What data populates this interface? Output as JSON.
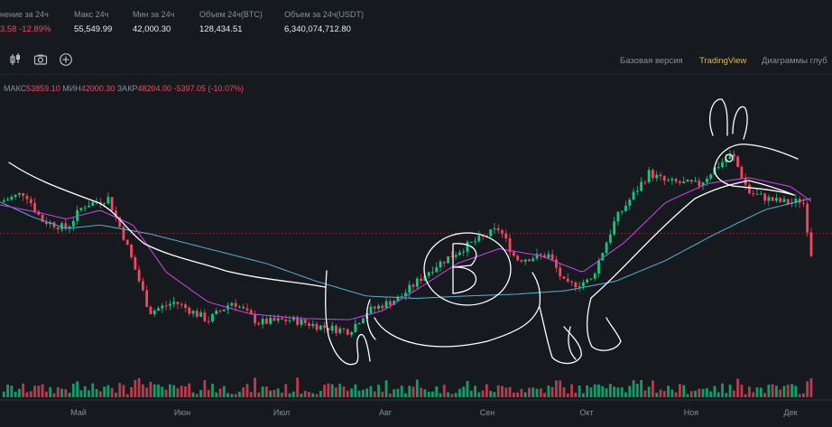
{
  "stats": [
    {
      "label": "нение за 24ч",
      "value": "3.58 -12.89%",
      "negative": true
    },
    {
      "label": "Макс 24ч",
      "value": "55,549.99",
      "negative": false
    },
    {
      "label": "Мин за 24ч",
      "value": "42,000.30",
      "negative": false
    },
    {
      "label": "Объем 24ч(BTC)",
      "value": "128,434.51",
      "negative": false
    },
    {
      "label": "Объем за 24ч(USDT)",
      "value": "6,340,074,712.80",
      "negative": false
    }
  ],
  "toolbar": {
    "icons": [
      "candlestick-icon",
      "camera-icon",
      "plus-circle-icon"
    ],
    "tabs": [
      "Базовая версия",
      "TradingView",
      "Диаграммы глуб"
    ],
    "active_tab": "TradingView"
  },
  "ohlc": {
    "high_label": "МАКС",
    "high": "53859.10",
    "low_label": "МИН",
    "low": "42000.30",
    "close_label": "ЗАКР",
    "close": "48204.00",
    "change": "-5397.05 (-10.07%)"
  },
  "colors": {
    "up": "#0ecb81",
    "down": "#f6465d",
    "ma_short": "#c33fe0",
    "ma_long": "#4aa7c9",
    "accent": "#f0b90b"
  },
  "chart_data": {
    "type": "candlestick",
    "x_ticks": [
      "Май",
      "Июн",
      "Июл",
      "Авг",
      "Сен",
      "Окт",
      "Ноя",
      "Дек"
    ],
    "price_path": [
      [
        0,
        56900
      ],
      [
        0.03,
        58500
      ],
      [
        0.05,
        53800
      ],
      [
        0.08,
        52400
      ],
      [
        0.1,
        56300
      ],
      [
        0.13,
        57500
      ],
      [
        0.15,
        50600
      ],
      [
        0.18,
        38300
      ],
      [
        0.21,
        40000
      ],
      [
        0.25,
        36900
      ],
      [
        0.28,
        40100
      ],
      [
        0.31,
        36500
      ],
      [
        0.35,
        37000
      ],
      [
        0.39,
        35700
      ],
      [
        0.42,
        35100
      ],
      [
        0.44,
        38300
      ],
      [
        0.48,
        40700
      ],
      [
        0.52,
        45800
      ],
      [
        0.56,
        49400
      ],
      [
        0.6,
        52400
      ],
      [
        0.62,
        47200
      ],
      [
        0.66,
        47900
      ],
      [
        0.68,
        42700
      ],
      [
        0.71,
        43600
      ],
      [
        0.74,
        54000
      ],
      [
        0.78,
        61800
      ],
      [
        0.8,
        60300
      ],
      [
        0.84,
        59800
      ],
      [
        0.86,
        62700
      ],
      [
        0.88,
        65000
      ],
      [
        0.9,
        58500
      ],
      [
        0.93,
        57100
      ],
      [
        0.95,
        56700
      ],
      [
        0.965,
        57300
      ],
      [
        0.975,
        48200
      ]
    ],
    "ma_short_path": [
      [
        0,
        56400
      ],
      [
        0.05,
        55000
      ],
      [
        0.08,
        54000
      ],
      [
        0.12,
        55500
      ],
      [
        0.16,
        53000
      ],
      [
        0.2,
        45000
      ],
      [
        0.25,
        40000
      ],
      [
        0.3,
        38000
      ],
      [
        0.36,
        37200
      ],
      [
        0.42,
        37000
      ],
      [
        0.46,
        38500
      ],
      [
        0.5,
        42000
      ],
      [
        0.55,
        46500
      ],
      [
        0.6,
        49000
      ],
      [
        0.65,
        47800
      ],
      [
        0.7,
        45000
      ],
      [
        0.75,
        50000
      ],
      [
        0.8,
        56800
      ],
      [
        0.85,
        60000
      ],
      [
        0.9,
        61000
      ],
      [
        0.95,
        59500
      ],
      [
        0.975,
        57000
      ]
    ],
    "ma_long_path": [
      [
        0,
        56900
      ],
      [
        0.04,
        54300
      ],
      [
        0.08,
        52400
      ],
      [
        0.12,
        53000
      ],
      [
        0.18,
        51500
      ],
      [
        0.25,
        49000
      ],
      [
        0.32,
        46500
      ],
      [
        0.38,
        43500
      ],
      [
        0.44,
        41000
      ],
      [
        0.5,
        40600
      ],
      [
        0.56,
        41000
      ],
      [
        0.62,
        41300
      ],
      [
        0.68,
        41900
      ],
      [
        0.74,
        43500
      ],
      [
        0.8,
        47000
      ],
      [
        0.86,
        51500
      ],
      [
        0.92,
        55600
      ],
      [
        0.975,
        57500
      ]
    ],
    "last_price_line": 51600,
    "ylim": [
      30000,
      75000
    ]
  }
}
